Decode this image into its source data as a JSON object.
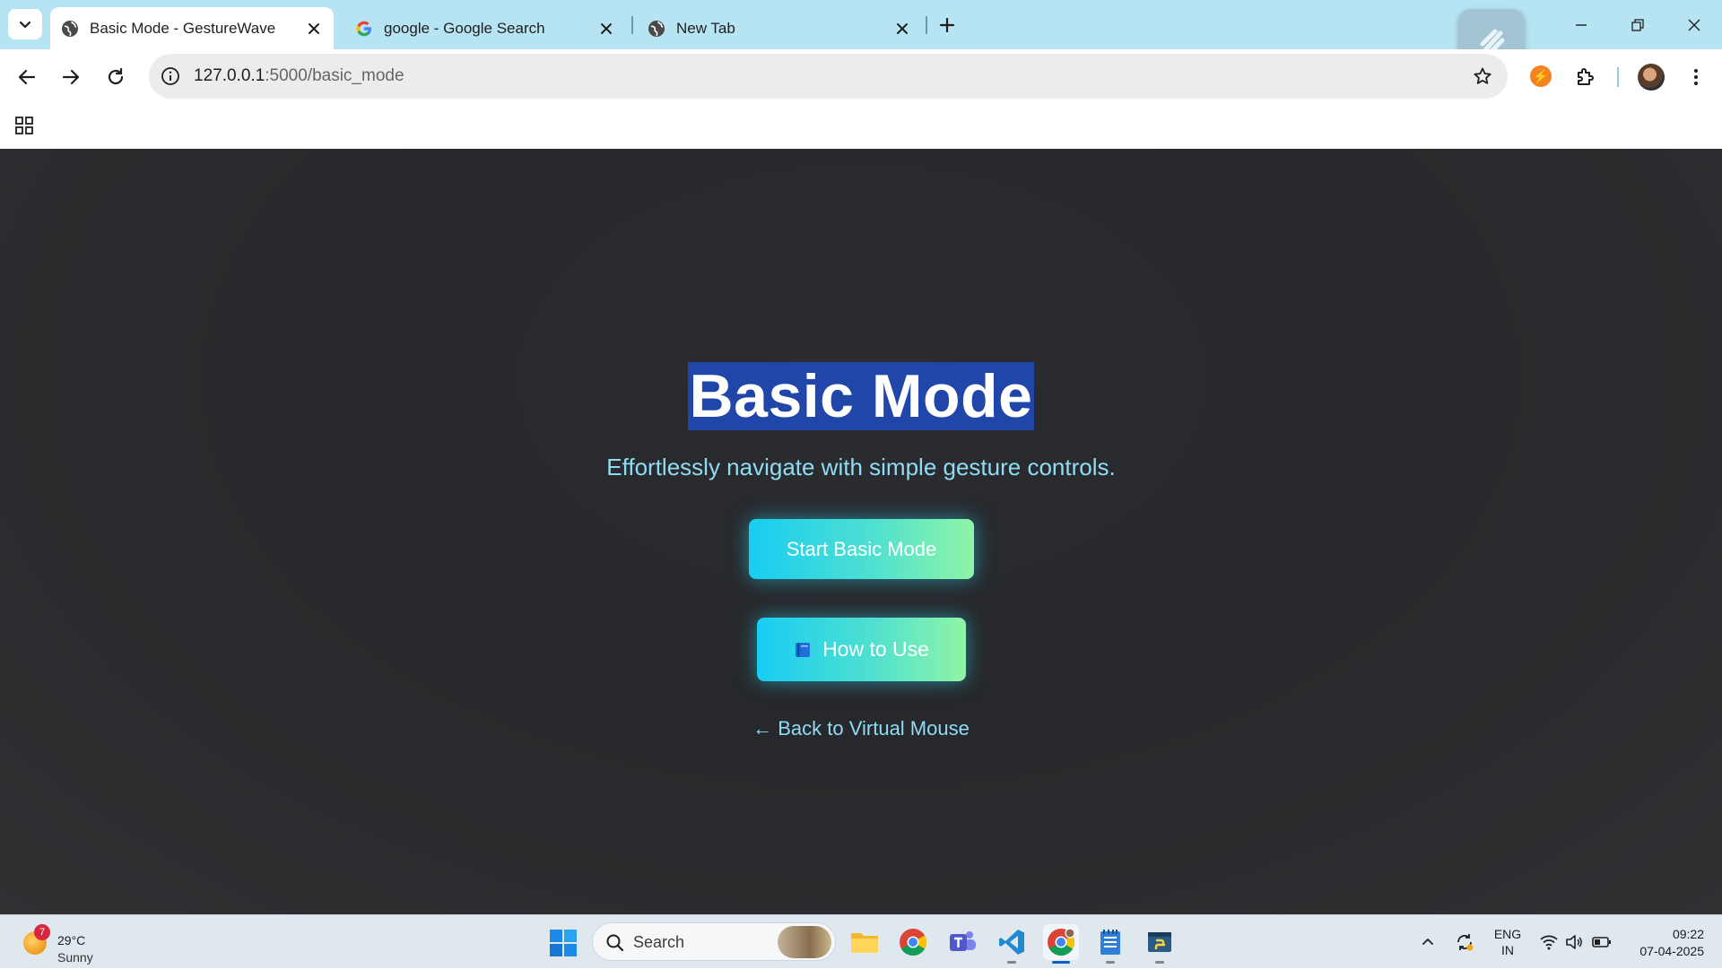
{
  "browser": {
    "tabs": [
      {
        "title": "Basic Mode - GestureWave",
        "active": true,
        "favicon": "globe-icon"
      },
      {
        "title": "google - Google Search",
        "active": false,
        "favicon": "google-icon"
      },
      {
        "title": "New Tab",
        "active": false,
        "favicon": "globe-icon"
      }
    ],
    "url": {
      "host": "127.0.0.1",
      "path": ":5000/basic_mode"
    }
  },
  "page": {
    "title": "Basic Mode",
    "subtitle": "Effortlessly navigate with simple gesture controls.",
    "start_button": "Start Basic Mode",
    "howto_button": "How to Use",
    "back_link": "← Back to Virtual Mouse"
  },
  "taskbar": {
    "weather": {
      "temp": "29°C",
      "condition": "Sunny",
      "badge": "7"
    },
    "search_placeholder": "Search",
    "language": {
      "line1": "ENG",
      "line2": "IN"
    },
    "clock": {
      "time": "09:22",
      "date": "07-04-2025"
    }
  },
  "colors": {
    "tabstrip_bg": "#b7e4f2",
    "page_bg": "#2a2c30",
    "title_highlight": "#1f46a8",
    "accent_cyan": "#18cdf2",
    "accent_green": "#8ff5a6",
    "link": "#8fdcf5"
  }
}
